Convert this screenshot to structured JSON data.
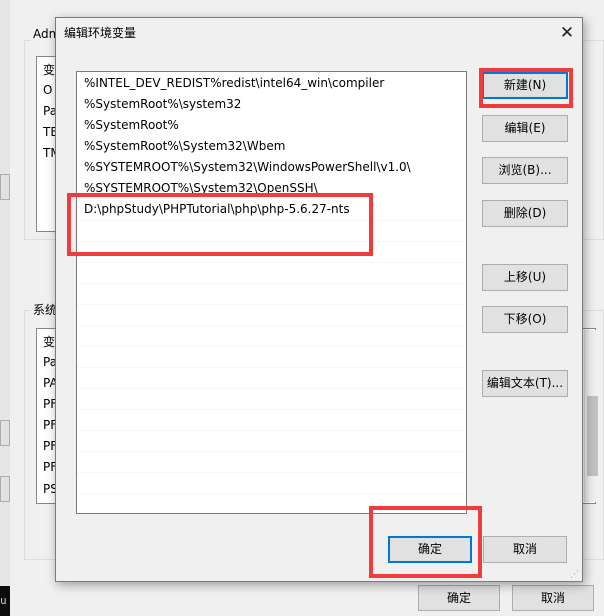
{
  "background": {
    "user_group_title": "Adm",
    "user_vars_partial": [
      "变",
      "O",
      "Pa",
      "TE",
      "TM"
    ],
    "system_group_title": "系统",
    "system_vars_partial": [
      "变",
      "Pa",
      "PA",
      "PF",
      "PF",
      "PF",
      "PF",
      "PS"
    ],
    "console_text": "u",
    "ok_label": "确定",
    "cancel_label": "取消"
  },
  "dialog": {
    "title": "编辑环境变量",
    "close_glyph": "✕",
    "path_entries": [
      "%INTEL_DEV_REDIST%redist\\intel64_win\\compiler",
      "%SystemRoot%\\system32",
      "%SystemRoot%",
      "%SystemRoot%\\System32\\Wbem",
      "%SYSTEMROOT%\\System32\\WindowsPowerShell\\v1.0\\",
      "%SYSTEMROOT%\\System32\\OpenSSH\\",
      "D:\\phpStudy\\PHPTutorial\\php\\php-5.6.27-nts"
    ],
    "buttons": {
      "new": "新建(N)",
      "edit": "编辑(E)",
      "browse": "浏览(B)...",
      "delete": "删除(D)",
      "move_up": "上移(U)",
      "move_down": "下移(O)",
      "edit_text": "编辑文本(T)...",
      "ok": "确定",
      "cancel": "取消"
    },
    "resize_grip_glyph": "⋰"
  },
  "colors": {
    "annotation_red": "#f03c3c",
    "focus_blue": "#0078d7"
  }
}
